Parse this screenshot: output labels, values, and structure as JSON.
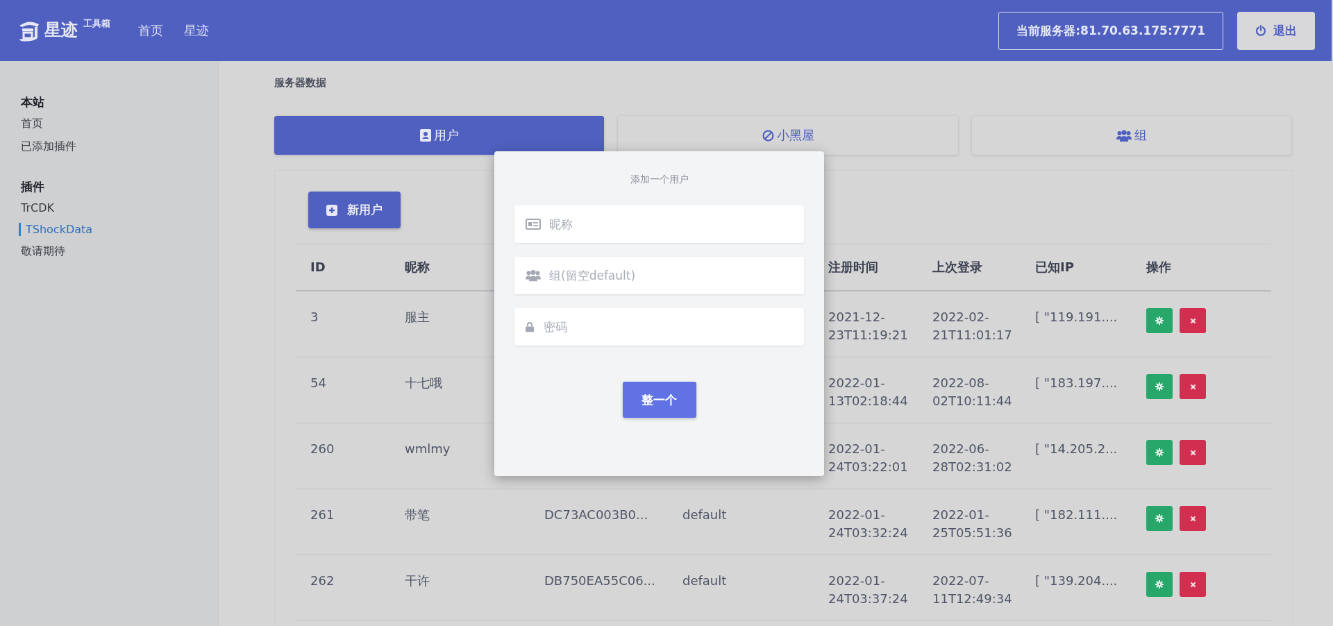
{
  "header": {
    "logo": {
      "name": "星迹",
      "tag": "工具箱"
    },
    "nav": [
      {
        "label": "首页"
      },
      {
        "label": "星迹"
      }
    ],
    "server": "当前服务器:81.70.63.175:7771",
    "logout": "退出"
  },
  "sidebar": {
    "sections": [
      {
        "title": "本站",
        "items": [
          {
            "label": "首页",
            "selected": false
          },
          {
            "label": "已添加插件",
            "selected": false
          }
        ]
      },
      {
        "title": "插件",
        "items": [
          {
            "label": "TrCDK",
            "selected": false
          },
          {
            "label": "TShockData",
            "selected": true
          },
          {
            "label": "敬请期待",
            "selected": false
          }
        ]
      }
    ]
  },
  "page_title": "服务器数据",
  "tabs": [
    {
      "kind": "user",
      "label": "用户",
      "selected": true
    },
    {
      "kind": "ban",
      "label": "小黑屋",
      "selected": false
    },
    {
      "kind": "group",
      "label": "组",
      "selected": false
    }
  ],
  "new_user_button": "新用户",
  "table": {
    "columns": [
      "ID",
      "昵称",
      null,
      null,
      "注册时间",
      "上次登录",
      "已知IP",
      "操作"
    ],
    "rows": [
      {
        "cells": [
          "3",
          "服主",
          null,
          null,
          "2021-12-23T11:19:21",
          "2022-02-21T11:01:17",
          "[ \"119.191...."
        ]
      },
      {
        "cells": [
          "54",
          "十七哦",
          null,
          null,
          "2022-01-13T02:18:44",
          "2022-08-02T10:11:44",
          "[ \"183.197...."
        ]
      },
      {
        "cells": [
          "260",
          "wmlmy",
          null,
          null,
          "2022-01-24T03:22:01",
          "2022-06-28T02:31:02",
          "[ \"14.205.2..."
        ]
      },
      {
        "cells": [
          "261",
          "带笔",
          "DC73AC003B0...",
          "default",
          "2022-01-24T03:32:24",
          "2022-01-25T05:51:36",
          "[ \"182.111...."
        ]
      },
      {
        "cells": [
          "262",
          "干许",
          "DB750EA55C06...",
          "default",
          "2022-01-24T03:37:24",
          "2022-07-11T12:49:34",
          "[ \"139.204...."
        ]
      }
    ]
  },
  "dialog": {
    "title": "添加一个用户",
    "fields": [
      {
        "kind": "card",
        "placeholder": "昵称"
      },
      {
        "kind": "group",
        "placeholder": "组(留空default)"
      },
      {
        "kind": "lock",
        "placeholder": "密码"
      }
    ],
    "submit": "整一个"
  }
}
